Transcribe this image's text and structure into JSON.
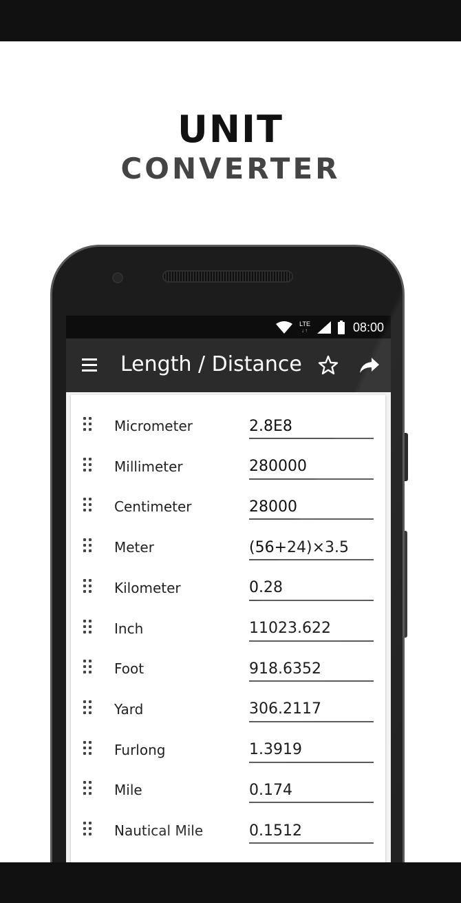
{
  "promo": {
    "line1": "UNIT",
    "line2": "CONVERTER"
  },
  "status_bar": {
    "network": "LTE",
    "network_arrows": "↓↑",
    "time": "08:00",
    "icons": [
      "wifi-icon",
      "lte-icon",
      "signal-icon",
      "battery-icon"
    ]
  },
  "app_bar": {
    "title": "Length / Distance",
    "icons": [
      "menu-icon",
      "star-icon",
      "share-icon"
    ]
  },
  "units": [
    {
      "name": "Micrometer",
      "value": "2.8E8"
    },
    {
      "name": "Millimeter",
      "value": "280000"
    },
    {
      "name": "Centimeter",
      "value": "28000"
    },
    {
      "name": "Meter",
      "value": "(56+24)×3.5"
    },
    {
      "name": "Kilometer",
      "value": "0.28"
    },
    {
      "name": "Inch",
      "value": "11023.622"
    },
    {
      "name": "Foot",
      "value": "918.6352"
    },
    {
      "name": "Yard",
      "value": "306.2117"
    },
    {
      "name": "Furlong",
      "value": "1.3919"
    },
    {
      "name": "Mile",
      "value": "0.174"
    },
    {
      "name": "Nautical Mile",
      "value": "0.1512"
    }
  ],
  "colors": {
    "app_bar": "#2b2b2b",
    "status_bar": "#0d0d0d",
    "frame_bars": "#111111"
  }
}
